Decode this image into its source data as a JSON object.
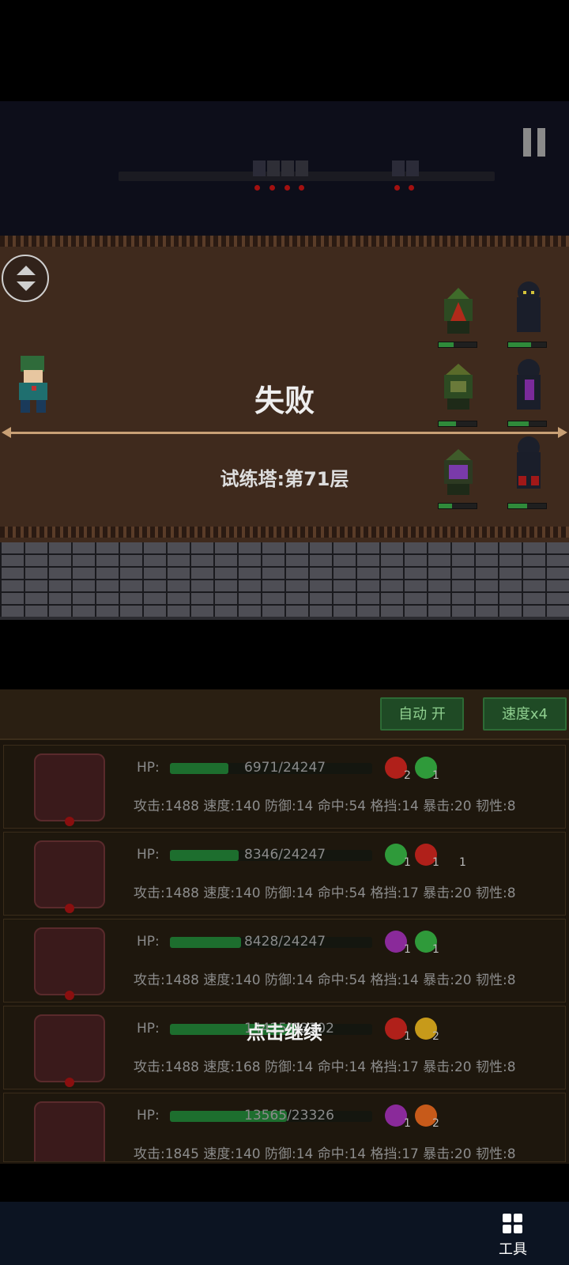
{
  "battle": {
    "result_title": "失败",
    "stage_label": "试练塔:第71层",
    "continue_hint": "点击继续"
  },
  "controls": {
    "auto_label": "自动 开",
    "speed_label": "速度x4",
    "tools_label": "工具"
  },
  "units": [
    {
      "hp_label": "HP:",
      "hp_text": "6971/24247",
      "hp_fraction": 0.29,
      "buffs": [
        {
          "icon": "flame-icon",
          "color": "#b0201a",
          "count": "2"
        },
        {
          "icon": "skull-icon",
          "color": "#2f9a3a",
          "count": "1"
        }
      ],
      "stats": "攻击:1488 速度:140 防御:14 命中:54 格挡:14 暴击:20 韧性:8"
    },
    {
      "hp_label": "HP:",
      "hp_text": "8346/24247",
      "hp_fraction": 0.34,
      "buffs": [
        {
          "icon": "skull-icon",
          "color": "#2f9a3a",
          "count": "1"
        },
        {
          "icon": "flame-icon",
          "color": "#b0201a",
          "count": "1"
        }
      ],
      "extra_count": "1",
      "stats": "攻击:1488 速度:140 防御:14 命中:54 格挡:17 暴击:20 韧性:8"
    },
    {
      "hp_label": "HP:",
      "hp_text": "8428/24247",
      "hp_fraction": 0.35,
      "buffs": [
        {
          "icon": "poison-skull-icon",
          "color": "#8a2a9a",
          "count": "1"
        },
        {
          "icon": "skull-icon",
          "color": "#2f9a3a",
          "count": "1"
        }
      ],
      "stats": "攻击:1488 速度:140 防御:14 命中:54 格挡:14 暴击:20 韧性:8"
    },
    {
      "hp_label": "HP:",
      "hp_text": "14425/23302",
      "hp_fraction": 0.62,
      "buffs": [
        {
          "icon": "flame-icon",
          "color": "#b0201a",
          "count": "1"
        },
        {
          "icon": "attack-up-icon",
          "color": "#c79a1a",
          "count": "2"
        }
      ],
      "stats": "攻击:1488 速度:168 防御:14 命中:14 格挡:17 暴击:20 韧性:8"
    },
    {
      "hp_label": "HP:",
      "hp_text": "13565/23326",
      "hp_fraction": 0.58,
      "buffs": [
        {
          "icon": "poison-skull-icon",
          "color": "#8a2a9a",
          "count": "1"
        },
        {
          "icon": "attack-up-icon",
          "color": "#c75a1a",
          "count": "2"
        }
      ],
      "stats": "攻击:1845 速度:140 防御:14 命中:14 格挡:17 暴击:20 韧性:8"
    }
  ],
  "colors": {
    "hp_fill": "#1d6e2e",
    "panel_bg": "#1c150c",
    "battlefield_bg": "#3f2a1d"
  }
}
